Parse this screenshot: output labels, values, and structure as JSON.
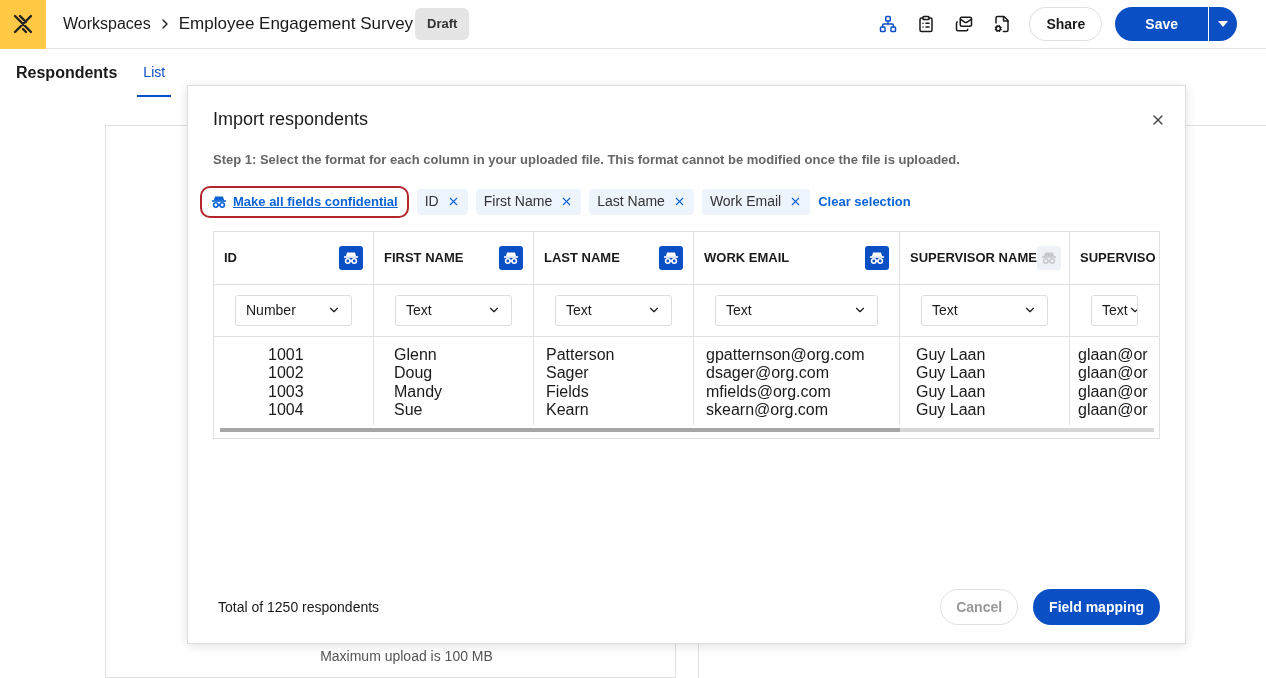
{
  "header": {
    "breadcrumb": "Workspaces",
    "title": "Employee Engagement Survey",
    "status": "Draft",
    "share": "Share",
    "save": "Save"
  },
  "page": {
    "heading": "Respondents",
    "tabs": [
      {
        "label": "List",
        "selected": true
      }
    ],
    "background_text": "Maximum upload is 100 MB"
  },
  "dialog": {
    "title": "Import respondents",
    "instruction": "Step 1: Select the format for each column in your uploaded file. This format cannot be modified once the file is uploaded.",
    "confidential_link": "Make all fields confidential",
    "chips": [
      "ID",
      "First Name",
      "Last Name",
      "Work Email"
    ],
    "clear": "Clear selection",
    "columns": [
      {
        "header": "ID",
        "confidential": true,
        "format": "Number",
        "values": [
          "1001",
          "1002",
          "1003",
          "1004"
        ]
      },
      {
        "header": "FIRST NAME",
        "confidential": true,
        "format": "Text",
        "values": [
          "Glenn",
          "Doug",
          "Mandy",
          "Sue"
        ]
      },
      {
        "header": "LAST NAME",
        "confidential": true,
        "format": "Text",
        "values": [
          "Patterson",
          "Sager",
          "Fields",
          "Kearn"
        ]
      },
      {
        "header": "WORK EMAIL",
        "confidential": true,
        "format": "Text",
        "values": [
          "gpatternson@org.com",
          "dsager@org.com",
          "mfields@org.com",
          "skearn@org.com"
        ]
      },
      {
        "header": "SUPERVISOR NAME",
        "confidential": false,
        "format": "Text",
        "values": [
          "Guy Laan",
          "Guy Laan",
          "Guy Laan",
          "Guy Laan"
        ]
      },
      {
        "header": "SUPERVISO",
        "format": "Text",
        "values": [
          "glaan@or",
          "glaan@or",
          "glaan@or",
          "glaan@or"
        ]
      }
    ],
    "total": "Total of 1250 respondents",
    "cancel": "Cancel",
    "primary": "Field mapping"
  }
}
